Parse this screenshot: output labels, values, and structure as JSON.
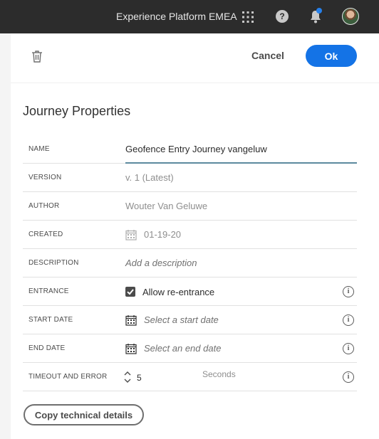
{
  "topbar": {
    "org_name": "Experience Platform EMEA",
    "icons": [
      "apps-icon",
      "help-icon",
      "bell-icon",
      "avatar"
    ]
  },
  "panel": {
    "cancel_label": "Cancel",
    "ok_label": "Ok",
    "title": "Journey Properties"
  },
  "properties": {
    "name": {
      "label": "NAME",
      "value": "Geofence Entry Journey vangeluw"
    },
    "version": {
      "label": "VERSION",
      "value": "v. 1 (Latest)"
    },
    "author": {
      "label": "AUTHOR",
      "value": "Wouter Van Geluwe"
    },
    "created": {
      "label": "CREATED",
      "value": "01-19-20"
    },
    "description": {
      "label": "DESCRIPTION",
      "placeholder": "Add a description"
    },
    "entrance": {
      "label": "ENTRANCE",
      "checkbox_label": "Allow re-entrance",
      "checked": true
    },
    "start_date": {
      "label": "START DATE",
      "placeholder": "Select a start date"
    },
    "end_date": {
      "label": "END DATE",
      "placeholder": "Select an end date"
    },
    "timeout": {
      "label": "TIMEOUT AND ERROR",
      "value": "5",
      "unit": "Seconds"
    }
  },
  "footer": {
    "copy_label": "Copy technical details"
  },
  "colors": {
    "topbar_bg": "#2c2c2c",
    "accent_blue": "#1473e6",
    "notification_dot": "#2680eb"
  }
}
